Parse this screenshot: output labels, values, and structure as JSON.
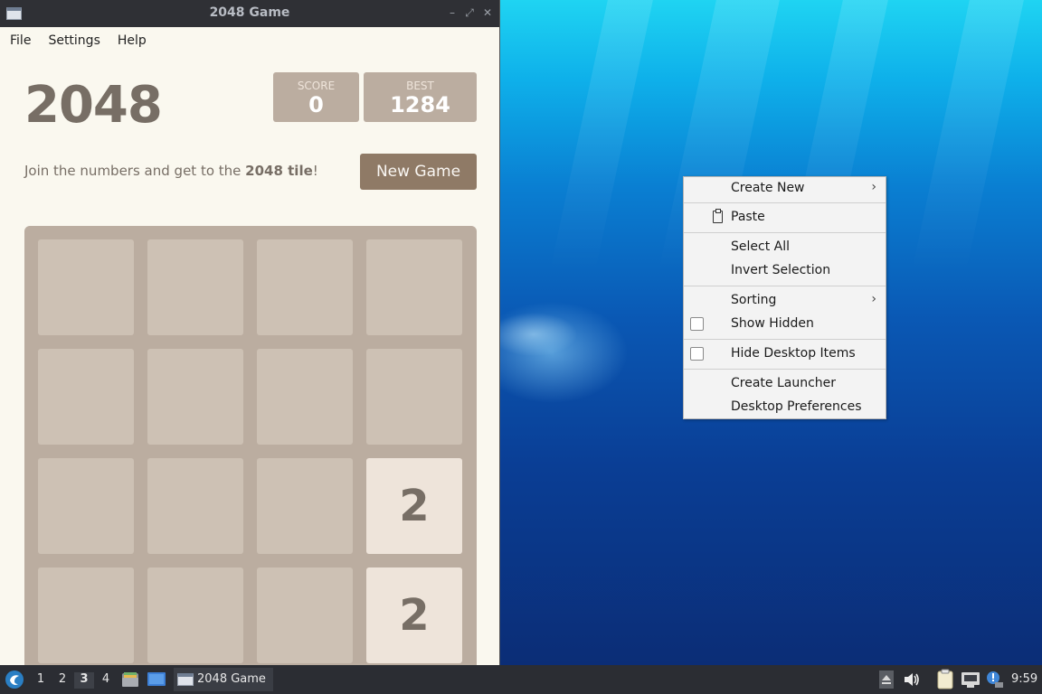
{
  "window": {
    "title": "2048 Game",
    "menu": [
      "File",
      "Settings",
      "Help"
    ]
  },
  "game": {
    "title": "2048",
    "score_label": "SCORE",
    "score": "0",
    "best_label": "BEST",
    "best": "1284",
    "intro_prefix": "Join the numbers and get to the ",
    "intro_bold": "2048 tile",
    "intro_suffix": "!",
    "new_game": "New Game",
    "grid": [
      [
        "",
        "",
        "",
        ""
      ],
      [
        "",
        "",
        "",
        ""
      ],
      [
        "",
        "",
        "",
        "2"
      ],
      [
        "",
        "",
        "",
        "2"
      ]
    ]
  },
  "context_menu": {
    "create_new": "Create New",
    "paste": "Paste",
    "select_all": "Select All",
    "invert_selection": "Invert Selection",
    "sorting": "Sorting",
    "show_hidden": "Show Hidden",
    "hide_desktop_items": "Hide Desktop Items",
    "create_launcher": "Create Launcher",
    "desktop_preferences": "Desktop Preferences"
  },
  "taskbar": {
    "workspaces": [
      "1",
      "2",
      "3",
      "4"
    ],
    "active_workspace": "3",
    "task_label": "2048 Game",
    "clock": "9:59",
    "icons": [
      "start-menu-icon",
      "file-manager-icon",
      "desktop-icon",
      "eject-icon",
      "volume-icon",
      "clipboard-icon",
      "network-icon",
      "notification-icon"
    ]
  },
  "colors": {
    "tile_empty": "#cdc1b4",
    "tile_2": "#eee4da",
    "board": "#bbada0",
    "new_game_button": "#8f7a66",
    "text_dark": "#776e65"
  }
}
